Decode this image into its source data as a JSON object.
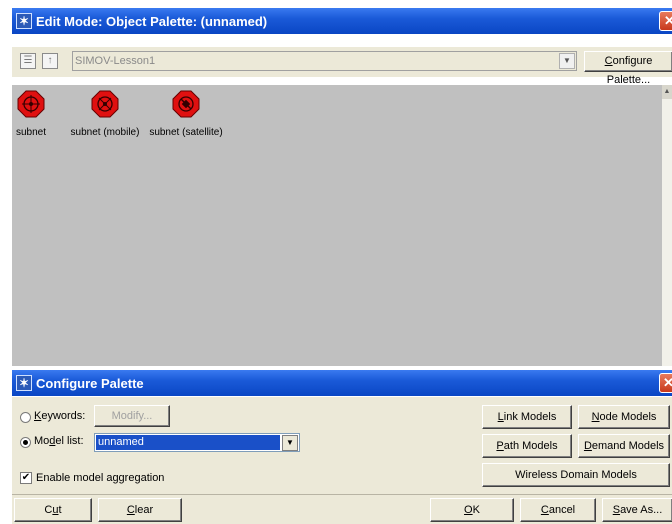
{
  "main_window": {
    "title": "Edit Mode: Object Palette: (unnamed)",
    "close_glyph": "✕",
    "toolbar": {
      "path_value": "SIMOV-Lesson1",
      "configure_button": "Configure Palette...",
      "configure_mnemonic": "C",
      "configure_rest": "onfigure Palette..."
    },
    "objects": [
      {
        "label": "subnet",
        "icon": "subnet-icon"
      },
      {
        "label": "subnet (mobile)",
        "icon": "subnet-mobile-icon"
      },
      {
        "label": "subnet (satellite)",
        "icon": "subnet-satellite-icon"
      }
    ]
  },
  "configure_palette": {
    "title": "Configure Palette",
    "close_glyph": "✕",
    "keywords_label": "Keywords:",
    "keywords_mnemonic": "K",
    "keywords_rest": "eywords:",
    "modify_button": "Modify...",
    "model_list_label": "Model list:",
    "model_list_pre": "Mo",
    "model_list_mnemonic": "d",
    "model_list_rest": "el list:",
    "model_list_value": "unnamed",
    "model_list_selected": true,
    "enable_aggregation": "Enable model aggregation",
    "enable_aggregation_checked": true,
    "buttons": {
      "link_models_m": "L",
      "link_models_r": "ink Models",
      "node_models_m": "N",
      "node_models_r": "ode Models",
      "path_models_m": "P",
      "path_models_r": "ath Models",
      "demand_models_m": "D",
      "demand_models_r": "emand Models",
      "wireless_domain": "Wireless Domain Models",
      "cut_pre": "C",
      "cut_m": "u",
      "cut_r": "t",
      "clear_m": "C",
      "clear_r": "lear",
      "ok_m": "O",
      "ok_r": "K",
      "cancel_m": "C",
      "cancel_r": "ancel",
      "save_as_m": "S",
      "save_as_r": "ave As..."
    }
  },
  "colors": {
    "title_blue": "#0a46c4",
    "canvas_gray": "#c0c0c0",
    "dialog_face": "#ece9d8",
    "selection_blue": "#1a50c8",
    "subnet_red": "#e01010"
  }
}
